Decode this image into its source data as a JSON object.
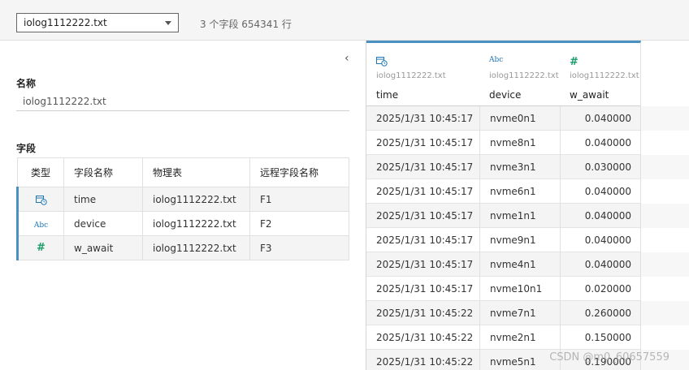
{
  "topbar": {
    "file_select": "iolog1112222.txt",
    "summary": "3 个字段 654341 行"
  },
  "left": {
    "collapse_glyph": "‹",
    "name_title": "名称",
    "name_value": "iolog1112222.txt",
    "fields_title": "字段",
    "table_headers": [
      "类型",
      "字段名称",
      "物理表",
      "远程字段名称"
    ],
    "fields": [
      {
        "type_icon": "date-time-icon",
        "name": "time",
        "table": "iolog1112222.txt",
        "remote": "F1"
      },
      {
        "type_icon": "string-icon",
        "type_text": "Abc",
        "name": "device",
        "table": "iolog1112222.txt",
        "remote": "F2"
      },
      {
        "type_icon": "number-icon",
        "type_text": "#",
        "name": "w_await",
        "table": "iolog1112222.txt",
        "remote": "F3"
      }
    ]
  },
  "grid": {
    "columns": [
      {
        "icon": "date-time-icon",
        "source": "iolog1112222.txt",
        "name": "time"
      },
      {
        "icon": "string-icon",
        "icon_text": "Abc",
        "source": "iolog1112222.txt",
        "name": "device"
      },
      {
        "icon": "number-icon",
        "icon_text": "#",
        "source": "iolog1112222.txt",
        "name": "w_await"
      }
    ],
    "rows": [
      [
        "2025/1/31 10:45:17",
        "nvme0n1",
        "0.040000"
      ],
      [
        "2025/1/31 10:45:17",
        "nvme8n1",
        "0.040000"
      ],
      [
        "2025/1/31 10:45:17",
        "nvme3n1",
        "0.030000"
      ],
      [
        "2025/1/31 10:45:17",
        "nvme6n1",
        "0.040000"
      ],
      [
        "2025/1/31 10:45:17",
        "nvme1n1",
        "0.040000"
      ],
      [
        "2025/1/31 10:45:17",
        "nvme9n1",
        "0.040000"
      ],
      [
        "2025/1/31 10:45:17",
        "nvme4n1",
        "0.040000"
      ],
      [
        "2025/1/31 10:45:17",
        "nvme10n1",
        "0.020000"
      ],
      [
        "2025/1/31 10:45:22",
        "nvme7n1",
        "0.260000"
      ],
      [
        "2025/1/31 10:45:22",
        "nvme2n1",
        "0.150000"
      ],
      [
        "2025/1/31 10:45:22",
        "nvme5n1",
        "0.190000"
      ]
    ]
  },
  "watermark": "CSDN @m0_60657559",
  "colors": {
    "accent": "#4a90c0",
    "string_icon": "#1f77b4",
    "number_icon": "#1a9e6a"
  }
}
